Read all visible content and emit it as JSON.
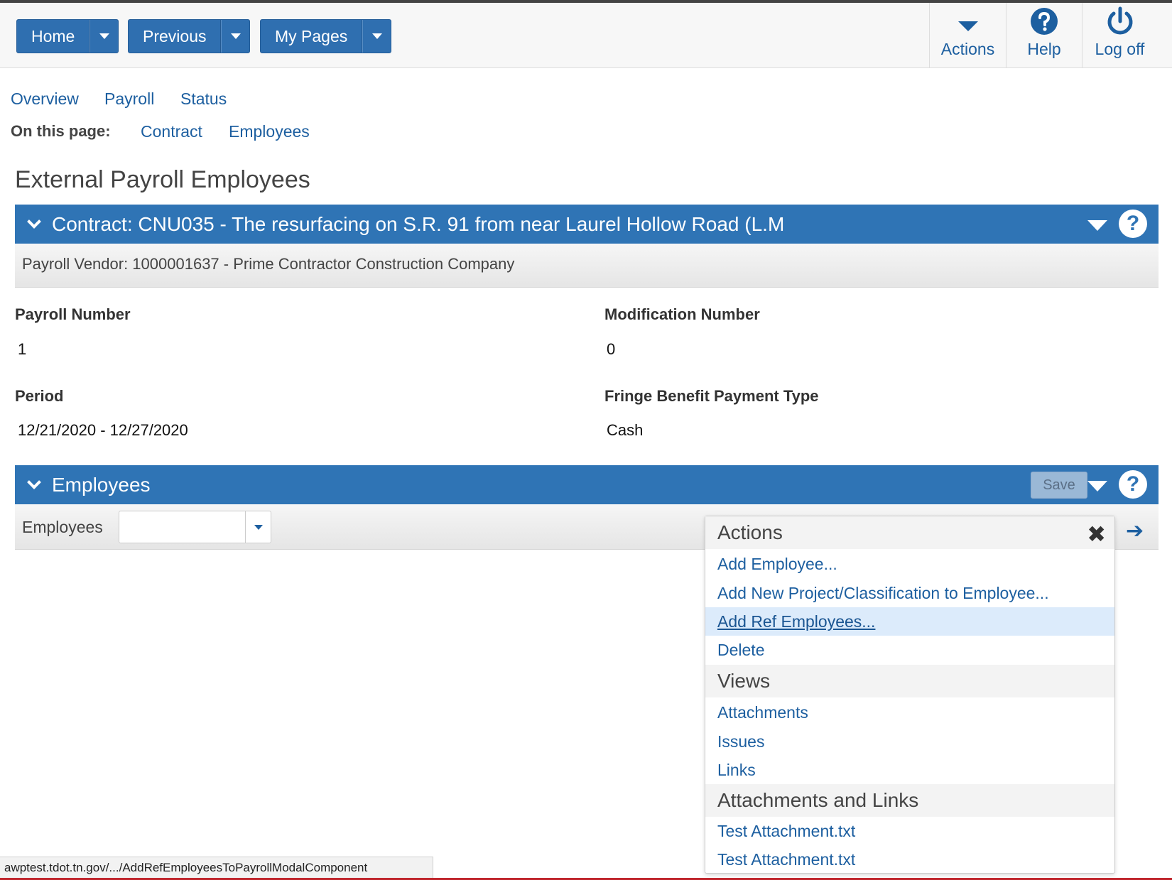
{
  "header": {
    "home_label": "Home",
    "previous_label": "Previous",
    "mypages_label": "My Pages",
    "actions_label": "Actions",
    "help_label": "Help",
    "logoff_label": "Log off"
  },
  "nav": {
    "links": [
      "Overview",
      "Payroll",
      "Status"
    ],
    "on_this_page_label": "On this page:",
    "on_this_page_links": [
      "Contract",
      "Employees"
    ]
  },
  "page_title": "External Payroll Employees",
  "contract_panel": {
    "title": "Contract: CNU035 - The resurfacing on S.R. 91 from near Laurel Hollow Road (L.M",
    "vendor": "Payroll Vendor: 1000001637 - Prime Contractor Construction Company"
  },
  "fields": {
    "payroll_number_label": "Payroll Number",
    "payroll_number_value": "1",
    "modification_number_label": "Modification Number",
    "modification_number_value": "0",
    "period_label": "Period",
    "period_value": "12/21/2020 - 12/27/2020",
    "fringe_label": "Fringe Benefit Payment Type",
    "fringe_value": "Cash"
  },
  "employees_panel": {
    "title": "Employees",
    "save_label": "Save",
    "select_label": "Employees",
    "select_value": ""
  },
  "actions_menu": {
    "actions_header": "Actions",
    "actions_items": [
      "Add Employee...",
      "Add New Project/Classification to Employee...",
      "Add Ref Employees...",
      "Delete"
    ],
    "highlighted_item": "Add Ref Employees...",
    "views_header": "Views",
    "views_items": [
      "Attachments",
      "Issues",
      "Links"
    ],
    "attach_header": "Attachments and Links",
    "attach_items": [
      "Test Attachment.txt",
      "Test Attachment.txt"
    ]
  },
  "status_bar": {
    "url": "awptest.tdot.tn.gov/.../AddRefEmployeesToPayrollModalComponent"
  },
  "colors": {
    "brand_blue": "#2f74b5",
    "link_blue": "#1d5fa0",
    "highlight": "#dcebfb"
  }
}
